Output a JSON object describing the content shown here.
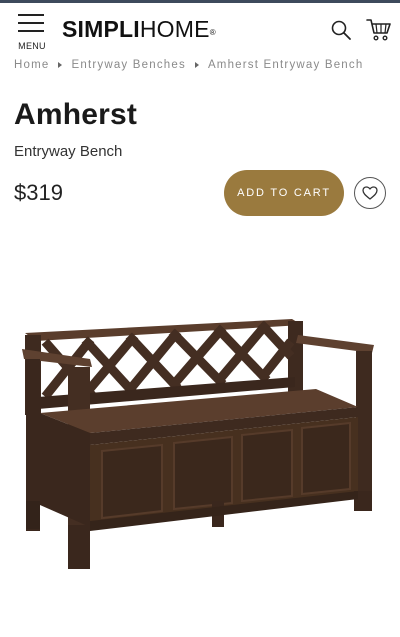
{
  "header": {
    "menu_label": "MENU",
    "logo": {
      "part1": "SIMPLI",
      "part2": "HOME",
      "mark": "®"
    }
  },
  "breadcrumb": {
    "items": [
      "Home",
      "Entryway Benches",
      "Amherst Entryway Bench"
    ]
  },
  "product": {
    "name": "Amherst",
    "category": "Entryway Bench",
    "price": "$319",
    "add_to_cart_label": "ADD TO CART",
    "image_alt": "Amherst Entryway Bench in dark brown wood with lattice backrest"
  },
  "colors": {
    "accent": "#9a7a3e",
    "wood": "#4a3326",
    "top_bar": "#3d4a5c"
  },
  "icons": [
    "hamburger-menu-icon",
    "search-icon",
    "cart-icon",
    "heart-icon"
  ]
}
